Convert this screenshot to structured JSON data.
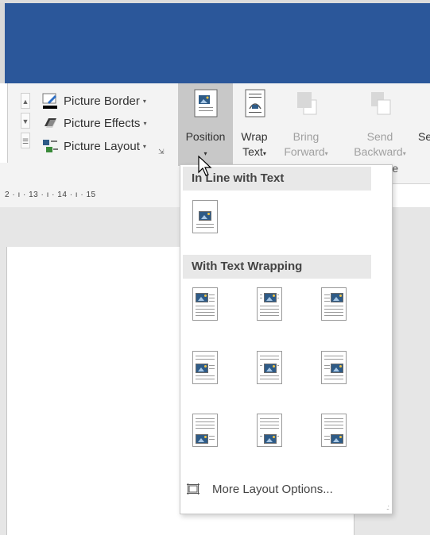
{
  "ribbon": {
    "picture_border": "Picture Border",
    "picture_effects": "Picture Effects",
    "picture_layout": "Picture Layout",
    "position": "Position",
    "wrap_text_line1": "Wrap",
    "wrap_text_line2": "Text",
    "bring_forward_line1": "Bring",
    "bring_forward_line2": "Forward",
    "send_backward_line1": "Send",
    "send_backward_line2": "Backward",
    "cut_label": "Se",
    "group_arrange_partial": "ange",
    "dropdown_arrow": "▾"
  },
  "ruler": {
    "text": "2 · ı · 13 · ı · 14 · ı · 15"
  },
  "menu": {
    "inline_header": "In Line with Text",
    "wrapping_header": "With Text Wrapping",
    "more_layout_options": "More Layout Options...",
    "grip": ".:"
  },
  "colors": {
    "title_bar": "#2b579a",
    "ribbon_bg": "#f3f3f3",
    "selected_button": "#c8c8c8",
    "picture_blue": "#2e5b87"
  }
}
